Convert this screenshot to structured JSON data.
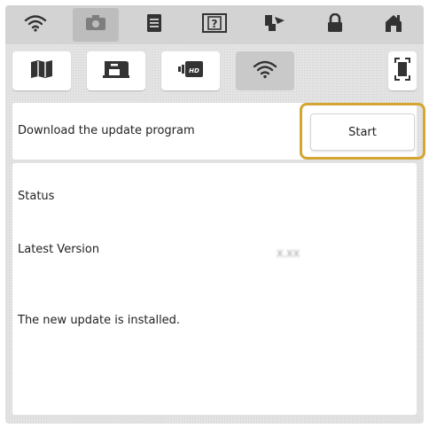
{
  "top_bar": {
    "tabs": [
      {
        "icon": "wifi-icon"
      },
      {
        "icon": "camera-icon"
      },
      {
        "icon": "document-icon"
      },
      {
        "icon": "help-icon"
      },
      {
        "icon": "machine-icon"
      },
      {
        "icon": "lock-icon"
      },
      {
        "icon": "home-icon"
      }
    ]
  },
  "sub_bar": {
    "buttons": [
      {
        "icon": "book-icon"
      },
      {
        "icon": "sewing-machine-icon"
      },
      {
        "icon": "video-icon"
      },
      {
        "icon": "wifi-icon"
      },
      {
        "icon": "screen-capture-icon"
      }
    ]
  },
  "download": {
    "label": "Download the update program",
    "start_label": "Start",
    "highlight_color": "#d4a531"
  },
  "status": {
    "status_label": "Status",
    "latest_version_label": "Latest Version",
    "latest_version_value": "X.XX",
    "message": "The new update is installed."
  }
}
